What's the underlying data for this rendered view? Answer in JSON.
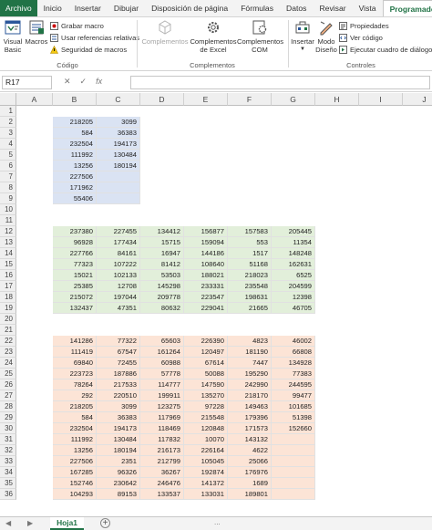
{
  "tabs": [
    "Archivo",
    "Inicio",
    "Insertar",
    "Dibujar",
    "Disposición de página",
    "Fórmulas",
    "Datos",
    "Revisar",
    "Vista",
    "Programador"
  ],
  "ribbon": {
    "codigo": {
      "label": "Código",
      "visual_basic": "Visual Basic",
      "macros": "Macros",
      "grabar": "Grabar macro",
      "referencias": "Usar referencias relativas",
      "seguridad": "Seguridad de macros"
    },
    "complementos": {
      "label": "Complementos",
      "complementos": "Complementos",
      "excel": "Complementos de Excel",
      "com": "Complementos COM"
    },
    "controles": {
      "label": "Controles",
      "insertar": "Insertar",
      "modo": "Modo Diseño",
      "propiedades": "Propiedades",
      "ver_codigo": "Ver código",
      "ejecutar": "Ejecutar cuadro de diálogo"
    }
  },
  "formula_bar": {
    "name_box": "R17",
    "fx": "fx",
    "value": ""
  },
  "columns": [
    "A",
    "B",
    "C",
    "D",
    "E",
    "F",
    "G",
    "H",
    "I",
    "J"
  ],
  "rows": [
    "1",
    "2",
    "3",
    "4",
    "5",
    "6",
    "7",
    "8",
    "9",
    "10",
    "11",
    "12",
    "13",
    "14",
    "15",
    "16",
    "17",
    "18",
    "19",
    "20",
    "21",
    "22",
    "23",
    "24",
    "25",
    "26",
    "27",
    "28",
    "29",
    "30",
    "31",
    "32",
    "33",
    "34",
    "35",
    "36"
  ],
  "sheet": {
    "name": "Hoja1",
    "add": "+",
    "more": "..."
  },
  "colors": {
    "excel_green": "#217346",
    "blue_fill": "#dae3f3",
    "green_fill": "#e2efda",
    "orange_fill": "#fce4d6"
  },
  "block1": [
    [
      "218205",
      "3099"
    ],
    [
      "584",
      "36383"
    ],
    [
      "232504",
      "194173"
    ],
    [
      "111992",
      "130484"
    ],
    [
      "13256",
      "180194"
    ],
    [
      "227506",
      ""
    ],
    [
      "171962",
      ""
    ],
    [
      "55406",
      ""
    ]
  ],
  "block2": [
    [
      "237380",
      "227455",
      "134412",
      "156877",
      "157583",
      "205445"
    ],
    [
      "96928",
      "177434",
      "15715",
      "159094",
      "553",
      "11354"
    ],
    [
      "227766",
      "84161",
      "16947",
      "144186",
      "1517",
      "148248"
    ],
    [
      "77323",
      "107222",
      "81412",
      "108640",
      "51168",
      "162631"
    ],
    [
      "15021",
      "102133",
      "53503",
      "188021",
      "218023",
      "6525"
    ],
    [
      "25385",
      "12708",
      "145298",
      "233331",
      "235548",
      "204599"
    ],
    [
      "215072",
      "197044",
      "209778",
      "223547",
      "198631",
      "12398"
    ],
    [
      "132437",
      "47351",
      "80632",
      "229041",
      "21665",
      "46705"
    ]
  ],
  "block3": [
    [
      "141286",
      "77322",
      "65603",
      "226390",
      "4823",
      "46002"
    ],
    [
      "111419",
      "67547",
      "161264",
      "120497",
      "181190",
      "66808"
    ],
    [
      "69840",
      "72455",
      "60988",
      "67614",
      "7447",
      "134928"
    ],
    [
      "223723",
      "187886",
      "57778",
      "50088",
      "195290",
      "77383"
    ],
    [
      "78264",
      "217533",
      "114777",
      "147590",
      "242990",
      "244595"
    ],
    [
      "292",
      "220510",
      "199911",
      "135270",
      "218170",
      "99477"
    ],
    [
      "218205",
      "3099",
      "123275",
      "97228",
      "149463",
      "101685"
    ],
    [
      "584",
      "36383",
      "117969",
      "215548",
      "179396",
      "51398"
    ],
    [
      "232504",
      "194173",
      "118469",
      "120848",
      "171573",
      "152660"
    ],
    [
      "111992",
      "130484",
      "117832",
      "10070",
      "143132",
      ""
    ],
    [
      "13256",
      "180194",
      "216173",
      "226164",
      "4622",
      ""
    ],
    [
      "227506",
      "2351",
      "212799",
      "105045",
      "25066",
      ""
    ],
    [
      "167285",
      "96326",
      "36267",
      "192874",
      "176976",
      ""
    ],
    [
      "152746",
      "230642",
      "246476",
      "141372",
      "1689",
      ""
    ],
    [
      "104293",
      "89153",
      "133537",
      "133031",
      "189801",
      ""
    ]
  ]
}
